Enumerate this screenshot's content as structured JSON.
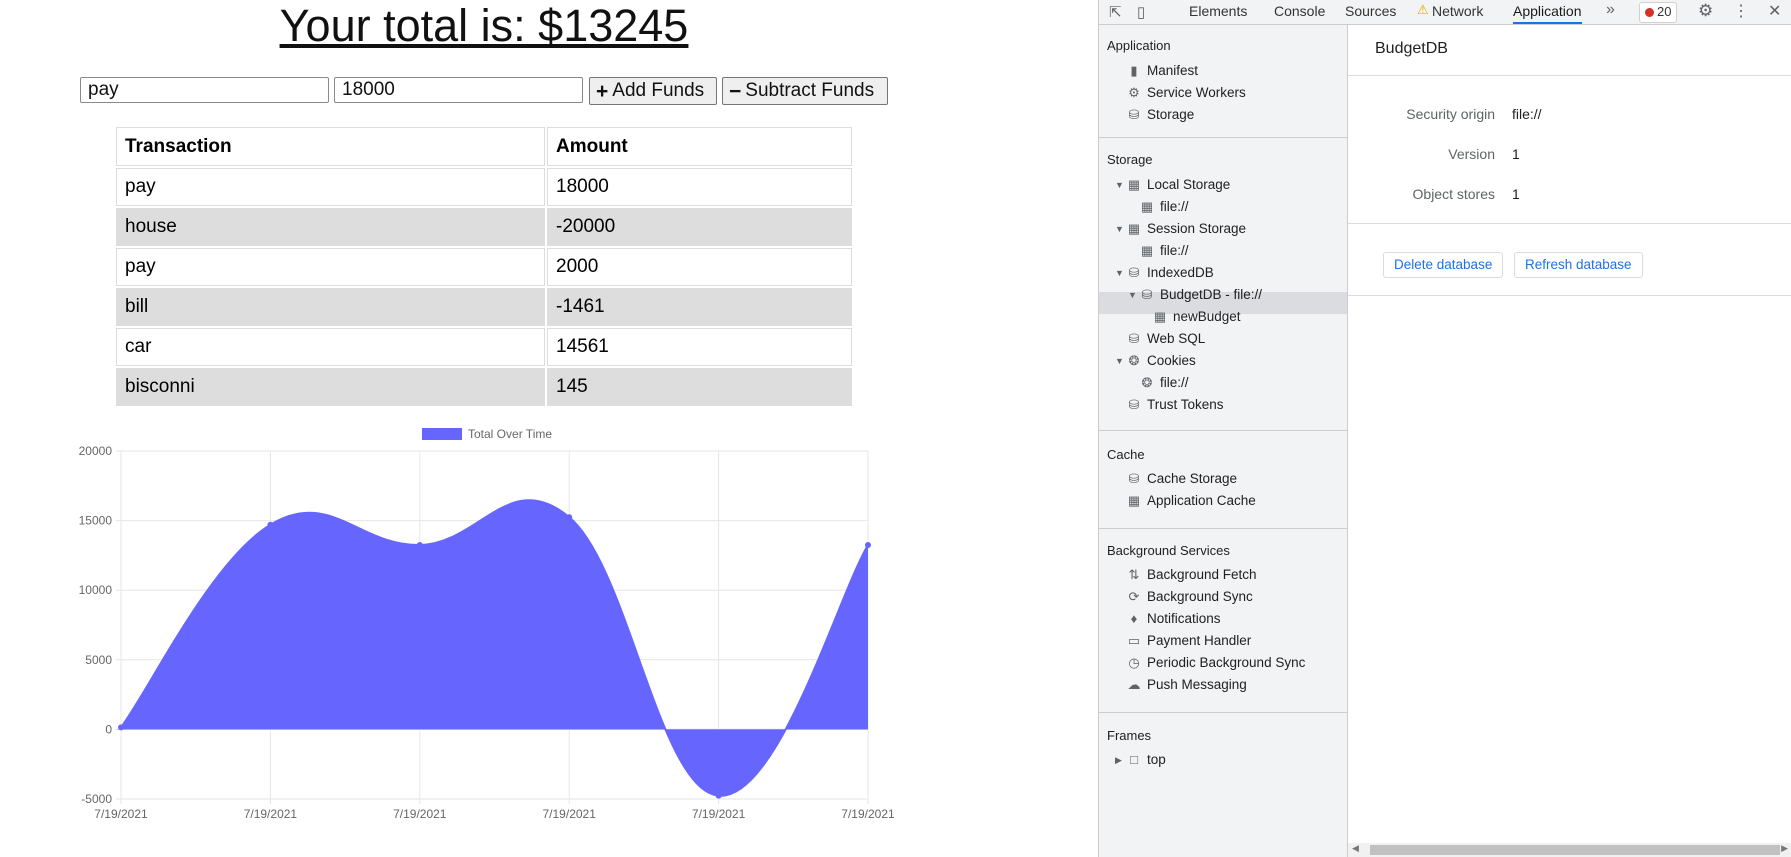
{
  "page": {
    "total_label": "Your total is: $",
    "total_value": "13245",
    "name_input_value": "pay",
    "amount_input_value": "18000",
    "add_button_label": "Add Funds",
    "subtract_button_label": "Subtract Funds",
    "table": {
      "headers": [
        "Transaction",
        "Amount"
      ],
      "rows": [
        [
          "pay",
          "18000"
        ],
        [
          "house",
          "-20000"
        ],
        [
          "pay",
          "2000"
        ],
        [
          "bill",
          "-1461"
        ],
        [
          "car",
          "14561"
        ],
        [
          "bisconni",
          "145"
        ]
      ]
    }
  },
  "chart_data": {
    "type": "area",
    "legend": "Total Over Time",
    "legend_position": "top",
    "x": [
      "7/19/2021",
      "7/19/2021",
      "7/19/2021",
      "7/19/2021",
      "7/19/2021",
      "7/19/2021"
    ],
    "series": [
      {
        "name": "Total Over Time",
        "values": [
          145,
          14706,
          13245,
          15245,
          -4755,
          13245
        ],
        "color": "#6666ff"
      }
    ],
    "ylim": [
      -5000,
      20000
    ],
    "yticks": [
      "20000",
      "15000",
      "10000",
      "5000",
      "0",
      "-5000"
    ],
    "grid": true
  },
  "devtools": {
    "tabs": [
      "Elements",
      "Console",
      "Sources",
      "Network",
      "Application"
    ],
    "active_tab": "Application",
    "error_count": "20",
    "sidebar": {
      "application_header": "Application",
      "application_items": [
        "Manifest",
        "Service Workers",
        "Storage"
      ],
      "storage_header": "Storage",
      "local_storage": "Local Storage",
      "local_storage_child": "file://",
      "session_storage": "Session Storage",
      "session_storage_child": "file://",
      "indexeddb": "IndexedDB",
      "indexeddb_db": "BudgetDB - file://",
      "indexeddb_store": "newBudget",
      "web_sql": "Web SQL",
      "cookies": "Cookies",
      "cookies_child": "file://",
      "trust_tokens": "Trust Tokens",
      "cache_header": "Cache",
      "cache_items": [
        "Cache Storage",
        "Application Cache"
      ],
      "bg_header": "Background Services",
      "bg_items": [
        "Background Fetch",
        "Background Sync",
        "Notifications",
        "Payment Handler",
        "Periodic Background Sync",
        "Push Messaging"
      ],
      "frames_header": "Frames",
      "frames_top": "top"
    },
    "main": {
      "title": "BudgetDB",
      "security_origin_label": "Security origin",
      "security_origin_value": "file://",
      "version_label": "Version",
      "version_value": "1",
      "object_stores_label": "Object stores",
      "object_stores_value": "1",
      "delete_button": "Delete database",
      "refresh_button": "Refresh database"
    }
  }
}
